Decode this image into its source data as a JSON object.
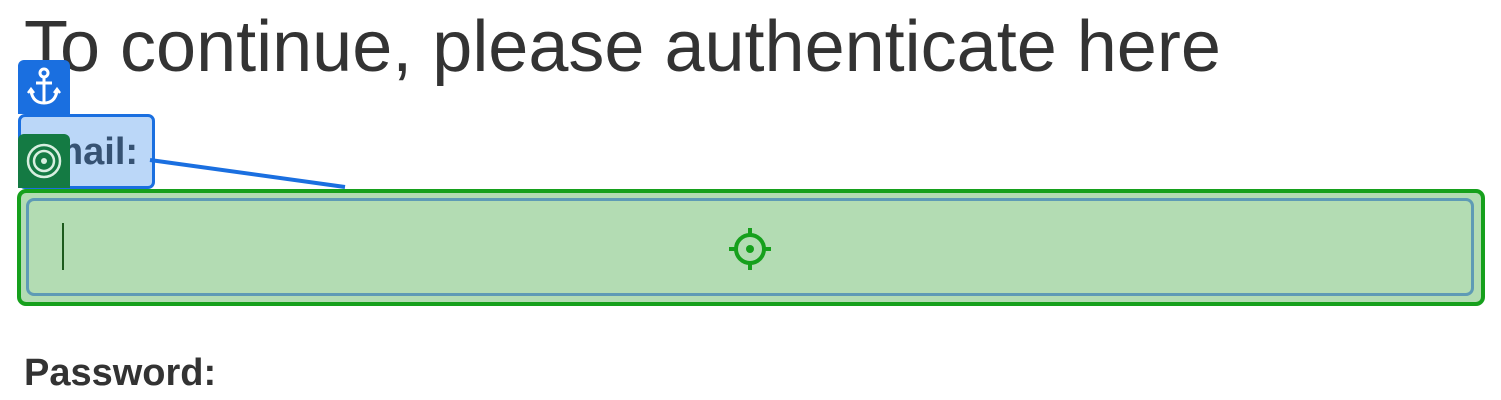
{
  "page": {
    "title": "To continue, please authenticate here"
  },
  "form": {
    "email_label": "Email:",
    "email_value": "",
    "password_label": "Password:"
  },
  "overlay": {
    "anchor_icon": "anchor-icon",
    "target_icon": "target-icon",
    "crosshair_icon": "crosshair-icon",
    "colors": {
      "label_highlight": "#1a6fe0",
      "input_highlight": "#16a01c",
      "target_badge": "#147a43"
    }
  }
}
